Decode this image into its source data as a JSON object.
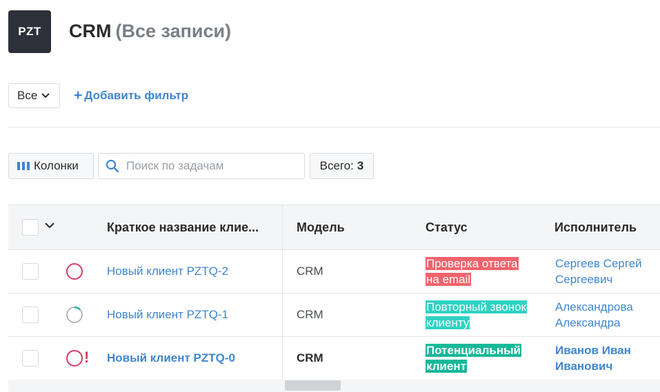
{
  "header": {
    "logo_text": "PZT",
    "title": "CRM",
    "subtitle": "(Все записи)"
  },
  "filters": {
    "select_value": "Все",
    "add_filter_label": "Добавить фильтр"
  },
  "toolbar": {
    "columns_label": "Колонки",
    "search_placeholder": "Поиск по задачам",
    "total_label": "Всего:",
    "total_value": "3"
  },
  "table": {
    "columns": [
      "Краткое название клие...",
      "Модель",
      "Статус",
      "Исполнитель"
    ],
    "rows": [
      {
        "name": "Новый клиент PZTQ-2",
        "model": "CRM",
        "status": "Проверка ответа на email",
        "status_color": "#f0636b",
        "assignee": "Сергеев Сергей Сергеевич",
        "progress_icon": "circle-empty-icon",
        "urgent": false,
        "bold": false
      },
      {
        "name": "Новый клиент PZTQ-1",
        "model": "CRM",
        "status": "Повторный звонок клиенту",
        "status_color": "#2fd3c3",
        "assignee": "Александрова Александра",
        "progress_icon": "circle-progress-icon",
        "urgent": false,
        "bold": false
      },
      {
        "name": "Новый клиент PZTQ-0",
        "model": "CRM",
        "status": "Потенциальный клиент",
        "status_color": "#17b898",
        "assignee": "Иванов Иван Иванович",
        "progress_icon": "circle-empty-icon",
        "urgent": true,
        "urgent_mark": "!",
        "bold": true
      }
    ]
  },
  "colors": {
    "accent": "#3f86d1",
    "logo_bg": "#2d3038",
    "urgent": "#d63a5f"
  }
}
